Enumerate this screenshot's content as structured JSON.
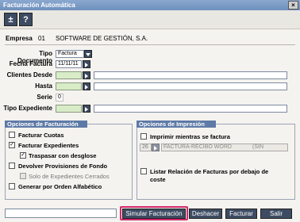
{
  "window": {
    "title": "Facturación Automática",
    "close_label": "×"
  },
  "toolbar": {
    "plus_label": "±",
    "help_label": "?"
  },
  "empresa": {
    "label": "Empresa",
    "code": "01",
    "name": "SOFTWARE DE GESTIÓN, S.A."
  },
  "form": {
    "tipo_documento": {
      "label": "Tipo Documento",
      "value": "Factura"
    },
    "fecha_factura": {
      "label": "Fecha Factura",
      "value": "11/11/11"
    },
    "clientes_desde": {
      "label": "Clientes Desde",
      "value": ""
    },
    "hasta": {
      "label": "Hasta",
      "value": ""
    },
    "serie": {
      "label": "Serie",
      "value": "0"
    },
    "tipo_expediente": {
      "label": "Tipo Expediente",
      "value": ""
    }
  },
  "opciones_facturacion": {
    "title": "Opciones de Facturación",
    "facturar_cuotas": {
      "label": "Facturar Cuotas",
      "checked": ""
    },
    "facturar_expedientes": {
      "label": "Facturar Expedientes",
      "checked": "✓"
    },
    "traspasar_desglose": {
      "label": "Traspasar con desglose",
      "checked": "✓"
    },
    "devolver_provisiones": {
      "label": "Devolver Provisiones de Fondo",
      "checked": ""
    },
    "solo_cerrados": {
      "label": "Solo de Expedientes Cerrados",
      "checked": ""
    },
    "generar_alfabetico": {
      "label": "Generar por Orden Alfabético",
      "checked": ""
    }
  },
  "opciones_impresion": {
    "title": "Opciones de Impresión",
    "imprimir_mientras": {
      "label": "Imprimir mientras se factura",
      "checked": ""
    },
    "formato_code": "26",
    "formato_name": "FACTURA-RECIBO WORD",
    "formato_extra": "(SIN",
    "listar_relacion": {
      "label": "Listar Relación de Facturas por debajo de coste",
      "checked": ""
    }
  },
  "buttons": {
    "simular": "Simular Facturación",
    "deshacer": "Deshacer",
    "facturar": "Facturar",
    "salir": "Salir"
  },
  "colors": {
    "accent": "#3d4c63",
    "group_header": "#5e7aa6",
    "highlight": "#d1286a"
  }
}
